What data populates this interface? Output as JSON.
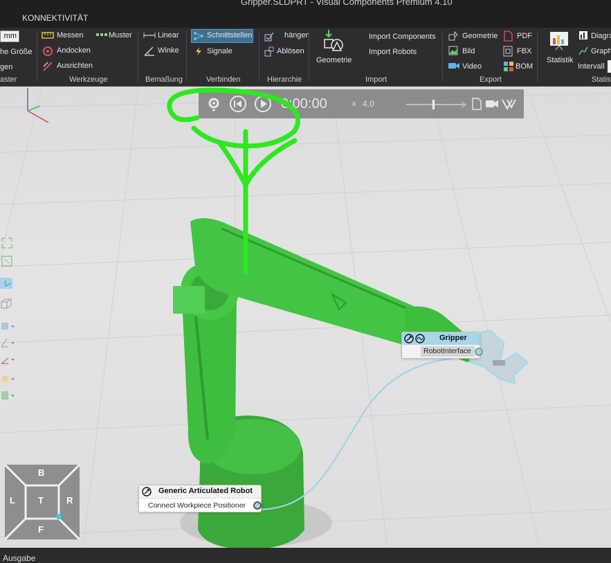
{
  "window": {
    "title": "Gripper.SLDPRT - Visual Components Premium 4.10"
  },
  "menu": {
    "tabs": [
      {
        "label": "KONNEKTIVITÄT"
      }
    ]
  },
  "ribbon": {
    "units": {
      "value": "mm",
      "line2": "he Größe",
      "line3": "gen"
    },
    "groups": {
      "raster": "aster",
      "werkzeuge": "Werkzeuge",
      "bemassung": "Bemaßung",
      "verbinden": "Verbinden",
      "hierarchie": "Hierarchie",
      "import": "Import",
      "export": "Export",
      "statistik": "Statist"
    },
    "werkzeuge": {
      "messen": "Messen",
      "muster": "Muster",
      "andocken": "Andocken",
      "ausrichten": "Ausrichten"
    },
    "bemassung": {
      "linear": "Linear",
      "winkel": "Winke"
    },
    "verbinden": {
      "schnittstellen": "Schnittstellen",
      "signale": "Signale"
    },
    "hierarchie": {
      "anhaengen": "hängen",
      "abloesen": "Ablösen"
    },
    "import": {
      "geometrie": "Geometrie",
      "import_components": "Import Components",
      "import_robots": "Import Robots"
    },
    "export": {
      "geometrie": "Geometrie",
      "bild": "Bild",
      "video": "Video",
      "pdf": "PDF",
      "fbx": "FBX",
      "bom": "BOM"
    },
    "statistik": {
      "statistik": "Statistik",
      "diagramm": "Diagra",
      "graph": "Graph",
      "intervall": "Intervall"
    }
  },
  "playback": {
    "time": "0:00:00",
    "speed": "4.0"
  },
  "nodes": {
    "gripper": {
      "title": "Gripper",
      "port": "RobotInterface"
    },
    "robot": {
      "title": "Generic Articulated Robot",
      "port": "Connect Workpiece Positioner"
    }
  },
  "navcube": {
    "top": "B",
    "left": "L",
    "center": "T",
    "right": "R",
    "bottom": "F"
  },
  "output_panel": {
    "label": "Ausgabe"
  },
  "colors": {
    "robot": "#3fc63f",
    "annotation": "#2ee81f",
    "connection": "#9fd3e6",
    "highlight": "#3f6f8f"
  }
}
